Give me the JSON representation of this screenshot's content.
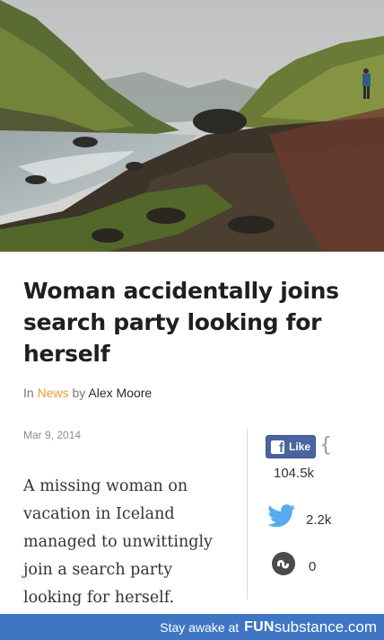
{
  "article": {
    "headline": "Woman accidentally joins search party looking for herself",
    "byline": {
      "prefix": "In",
      "category": "News",
      "by": "by",
      "author": "Alex Moore"
    },
    "date": "Mar 9, 2014",
    "summary": "A missing woman on vacation in Iceland managed to unwittingly join a search party looking for herself."
  },
  "social": {
    "facebook": {
      "label": "Like",
      "count": "104.5k",
      "icon": "facebook-icon"
    },
    "twitter": {
      "count": "2.2k",
      "icon": "twitter-bird-icon"
    },
    "stumbleupon": {
      "count": "0",
      "icon": "stumbleupon-icon"
    }
  },
  "footer": {
    "tagline": "Stay awake at",
    "brand_part1": "FUN",
    "brand_part2": "substance.com"
  },
  "colors": {
    "category": "#e79a3a",
    "facebook": "#4a64a0",
    "twitter": "#55acee",
    "footer_bg": "#3f76c4"
  }
}
